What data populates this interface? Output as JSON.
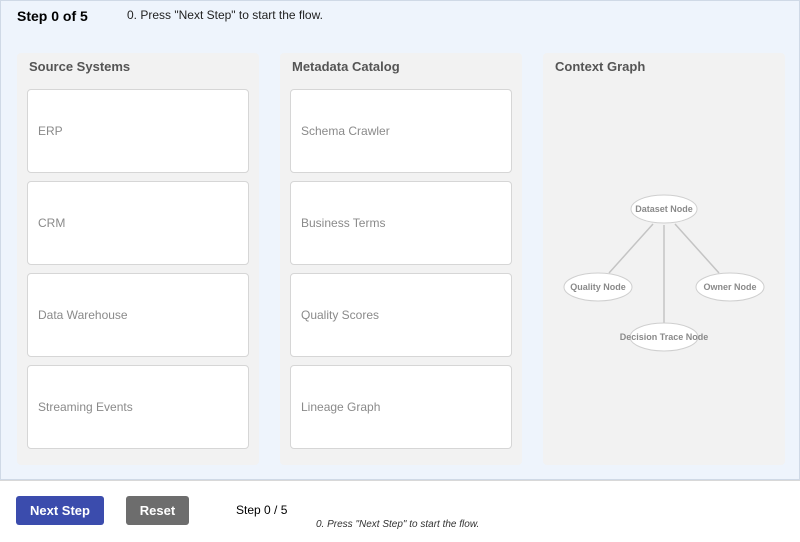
{
  "header": {
    "step_title": "Step 0 of 5",
    "step_description": "0. Press \"Next Step\" to start the flow."
  },
  "panels": {
    "source": {
      "title": "Source Systems",
      "items": [
        "ERP",
        "CRM",
        "Data Warehouse",
        "Streaming Events"
      ]
    },
    "catalog": {
      "title": "Metadata Catalog",
      "items": [
        "Schema Crawler",
        "Business Terms",
        "Quality Scores",
        "Lineage Graph"
      ]
    },
    "graph": {
      "title": "Context Graph",
      "nodes": {
        "dataset": "Dataset Node",
        "quality": "Quality Node",
        "owner": "Owner Node",
        "decision": "Decision Trace Node"
      }
    }
  },
  "controls": {
    "next_label": "Next Step",
    "reset_label": "Reset",
    "counter": "Step 0 / 5",
    "hint": "0. Press \"Next Step\" to start the flow."
  },
  "colors": {
    "next_button": "#3b4cad",
    "reset_button": "#6d6d6d",
    "stage_background": "#eef4fc",
    "panel_background": "#f2f2f2"
  }
}
